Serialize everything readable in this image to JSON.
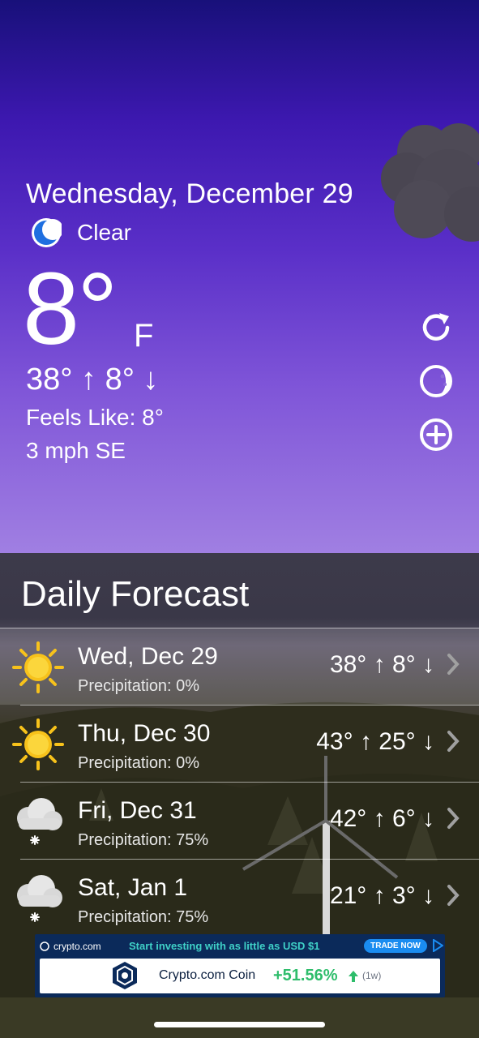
{
  "current": {
    "date": "Wednesday, December 29",
    "condition": "Clear",
    "condition_icon": "moon-icon",
    "temperature": "8°",
    "unit": "F",
    "high_low": "38° ↑  8° ↓",
    "feels_like": "Feels Like: 8°",
    "wind": "3 mph SE"
  },
  "side_actions": [
    {
      "icon": "refresh-icon"
    },
    {
      "icon": "moon-phase-icon"
    },
    {
      "icon": "add-location-icon"
    }
  ],
  "forecast": {
    "title": "Daily Forecast",
    "days": [
      {
        "day": "Wed, Dec 29",
        "precipitation": "Precipitation: 0%",
        "temps": "38° ↑  8° ↓",
        "icon": "sun-icon"
      },
      {
        "day": "Thu, Dec 30",
        "precipitation": "Precipitation: 0%",
        "temps": "43° ↑  25° ↓",
        "icon": "sun-icon"
      },
      {
        "day": "Fri, Dec 31",
        "precipitation": "Precipitation: 75%",
        "temps": "42° ↑  6° ↓",
        "icon": "snow-cloud-icon"
      },
      {
        "day": "Sat, Jan 1",
        "precipitation": "Precipitation: 75%",
        "temps": "21° ↑  3° ↓",
        "icon": "snow-cloud-icon"
      }
    ]
  },
  "ad": {
    "brand": "crypto.com",
    "tagline": "Start investing with as little as USD $1",
    "cta": "TRADE NOW",
    "coin_name": "Crypto.com Coin",
    "change": "+51.56%",
    "period": "(1w)"
  },
  "colors": {
    "sky_top": "#18107a",
    "sky_bottom": "#a07fe2",
    "sun": "#f7c21b",
    "ad_bg": "#0b2a5a",
    "ad_accent": "#3fd0c7",
    "gain": "#2ebd6b"
  }
}
